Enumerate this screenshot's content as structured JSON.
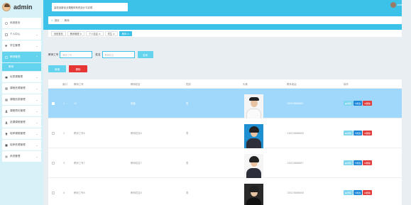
{
  "app": {
    "title": "admin",
    "header_title": "高校创新创业课程体系的设计与实现",
    "user_name": "admin"
  },
  "breadcrumb": {
    "home": "首页",
    "current": "教师"
  },
  "tabs": [
    {
      "label": "系统首页"
    },
    {
      "label": "教师管理 ×"
    },
    {
      "label": "个人信息 ×"
    },
    {
      "label": "学生 ×"
    },
    {
      "label": "教师 ×"
    }
  ],
  "sidebar": {
    "items": [
      {
        "label": "系统首页",
        "icon": "home-icon"
      },
      {
        "label": "个人中心",
        "icon": "user-icon"
      },
      {
        "label": "学生管理",
        "icon": "flag-icon"
      },
      {
        "label": "教师管理",
        "icon": "grid-icon"
      },
      {
        "label": "教师",
        "icon": ""
      },
      {
        "label": "优质课管理",
        "icon": "folder-icon"
      },
      {
        "label": "课程资源管理",
        "icon": "apps-icon"
      },
      {
        "label": "课程信息管理",
        "icon": "apps-icon"
      },
      {
        "label": "课程预约管理",
        "icon": "person-icon"
      },
      {
        "label": "选课课程管理",
        "icon": "person-icon"
      },
      {
        "label": "培养课程管理",
        "icon": "bulb-icon"
      },
      {
        "label": "培养资源管理",
        "icon": "grid-icon"
      },
      {
        "label": "系统管理",
        "icon": "list-icon"
      }
    ]
  },
  "search": {
    "teacher_no_label": "教师工号",
    "teacher_no_placeholder": "教师工号",
    "name_label": "姓名",
    "name_placeholder": "教师姓名",
    "search_button": "查询"
  },
  "actions": {
    "add": "新增",
    "delete": "删除"
  },
  "table": {
    "headers": [
      "",
      "索引",
      "教师工号",
      "教师姓名",
      "性别",
      "头像",
      "联系电话",
      "操作"
    ],
    "rows": [
      {
        "index": "1",
        "teacher_no": "11",
        "name": "张薇",
        "gender": "男",
        "phone": "13823888881"
      },
      {
        "index": "2",
        "teacher_no": "教师工号6",
        "name": "教师姓名6",
        "gender": "男",
        "phone": "13823888886"
      },
      {
        "index": "3",
        "teacher_no": "教师工号7",
        "name": "教师姓名7",
        "gender": "男",
        "phone": "13823888887"
      },
      {
        "index": "4",
        "teacher_no": "教师工号8",
        "name": "教师姓名8",
        "gender": "男",
        "phone": "13823888888"
      }
    ],
    "op_view": "详情",
    "op_edit": "修改",
    "op_delete": "删除"
  },
  "colors": {
    "header": "#3cc2e9",
    "accent": "#63d3ee",
    "danger": "#e53535",
    "selected_row": "#9fd8fb"
  }
}
